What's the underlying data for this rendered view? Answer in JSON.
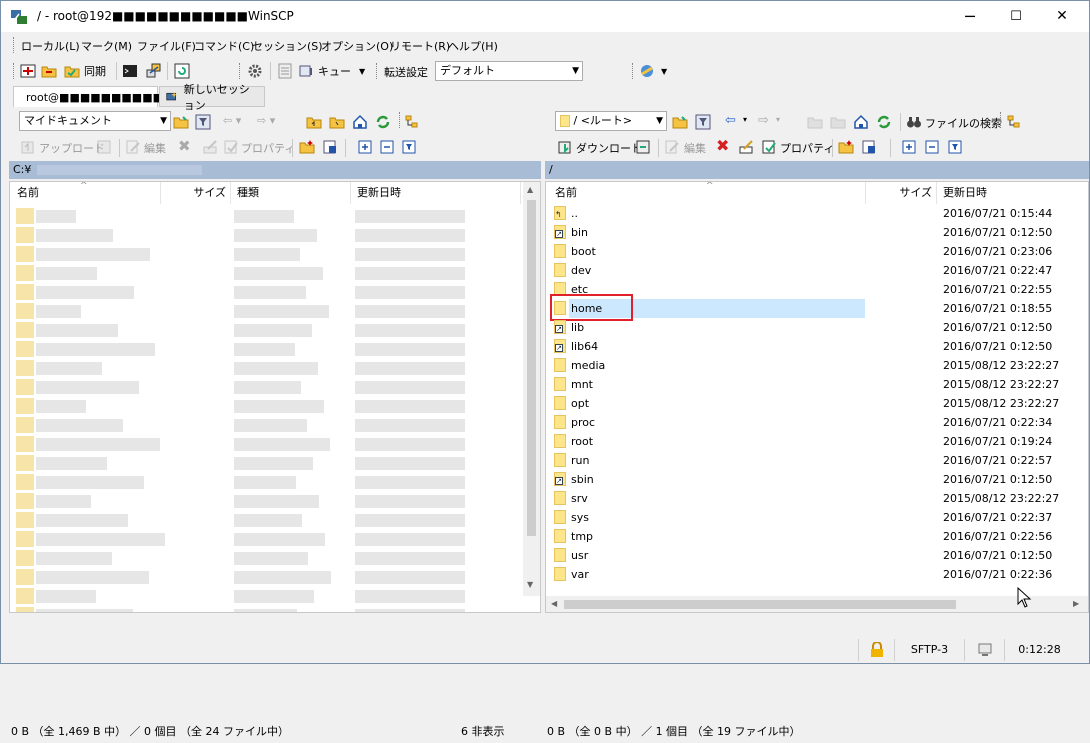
{
  "window": {
    "title": "/ - root@192■■■■■■■■■■■■WinSCP",
    "controls": {
      "minimize": "─",
      "maximize": "☐",
      "close": "✕"
    }
  },
  "menu": [
    "ローカル(L)",
    "マーク(M)",
    "ファイル(F)",
    "コマンド(C)",
    "セッション(S)",
    "オプション(O)",
    "リモート(R)",
    "ヘルプ(H)"
  ],
  "toolbar": {
    "sync_label": "同期",
    "queue_label": "キュー",
    "transfer_settings_label": "転送設定",
    "transfer_preset": "デフォルト"
  },
  "tabs": [
    {
      "label": "root@■■■■■■■■■■"
    },
    {
      "label": "新しいセッション"
    }
  ],
  "local": {
    "location_combo": "マイドキュメント",
    "upload_label": "アップロード",
    "edit_label": "編集",
    "properties_label": "プロパティ",
    "path": "C:¥",
    "columns": {
      "name": "名前",
      "size": "サイズ",
      "type": "種類",
      "modified": "更新日時"
    },
    "status": "0 B （全 1,469 B 中） ／ 0 個目 （全 24 ファイル中）",
    "hidden": "6 非表示"
  },
  "remote": {
    "location_combo": "/ <ルート>",
    "download_label": "ダウンロード",
    "edit_label": "編集",
    "properties_label": "プロパティ",
    "find_files_label": "ファイルの検索",
    "path": "/",
    "columns": {
      "name": "名前",
      "size": "サイズ",
      "modified": "更新日時"
    },
    "files": [
      {
        "name": "..",
        "modified": "2016/07/21 0:15:44",
        "kind": "parent"
      },
      {
        "name": "bin",
        "modified": "2016/07/21 0:12:50",
        "kind": "link"
      },
      {
        "name": "boot",
        "modified": "2016/07/21 0:23:06",
        "kind": "folder"
      },
      {
        "name": "dev",
        "modified": "2016/07/21 0:22:47",
        "kind": "folder"
      },
      {
        "name": "etc",
        "modified": "2016/07/21 0:22:55",
        "kind": "folder"
      },
      {
        "name": "home",
        "modified": "2016/07/21 0:18:55",
        "kind": "folder",
        "selected": true
      },
      {
        "name": "lib",
        "modified": "2016/07/21 0:12:50",
        "kind": "link"
      },
      {
        "name": "lib64",
        "modified": "2016/07/21 0:12:50",
        "kind": "link"
      },
      {
        "name": "media",
        "modified": "2015/08/12 23:22:27",
        "kind": "folder"
      },
      {
        "name": "mnt",
        "modified": "2015/08/12 23:22:27",
        "kind": "folder"
      },
      {
        "name": "opt",
        "modified": "2015/08/12 23:22:27",
        "kind": "folder"
      },
      {
        "name": "proc",
        "modified": "2016/07/21 0:22:34",
        "kind": "folder"
      },
      {
        "name": "root",
        "modified": "2016/07/21 0:19:24",
        "kind": "folder"
      },
      {
        "name": "run",
        "modified": "2016/07/21 0:22:57",
        "kind": "folder"
      },
      {
        "name": "sbin",
        "modified": "2016/07/21 0:12:50",
        "kind": "link"
      },
      {
        "name": "srv",
        "modified": "2015/08/12 23:22:27",
        "kind": "folder"
      },
      {
        "name": "sys",
        "modified": "2016/07/21 0:22:37",
        "kind": "folder"
      },
      {
        "name": "tmp",
        "modified": "2016/07/21 0:22:56",
        "kind": "folder"
      },
      {
        "name": "usr",
        "modified": "2016/07/21 0:12:50",
        "kind": "folder"
      },
      {
        "name": "var",
        "modified": "2016/07/21 0:22:36",
        "kind": "folder"
      }
    ],
    "status": "0 B （全 0 B 中） ／ 1 個目 （全 19 ファイル中）"
  },
  "bottom_status": {
    "protocol": "SFTP-3",
    "elapsed": "0:12:28"
  },
  "colors": {
    "path_bar": "#a8bcd6",
    "selection": "#cce8ff",
    "highlight": "#e0202a",
    "folder": "#fde68a"
  }
}
